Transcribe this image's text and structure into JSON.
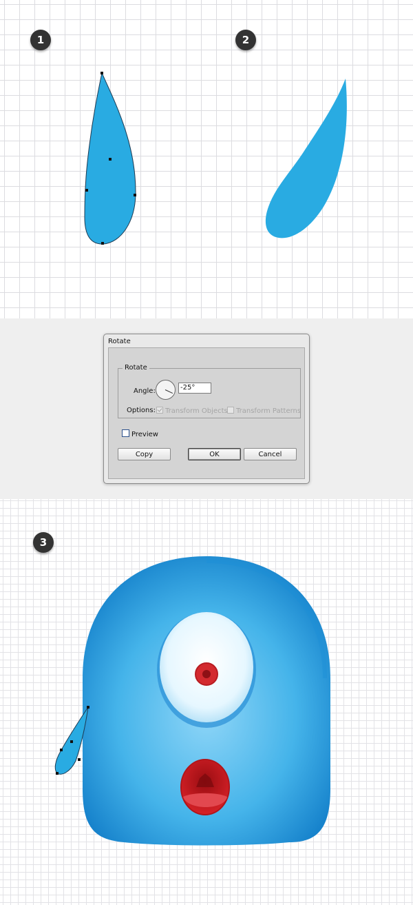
{
  "steps": {
    "one": "1",
    "two": "2",
    "three": "3"
  },
  "dialog": {
    "title": "Rotate",
    "group_title": "Rotate",
    "angle_label": "Angle:",
    "angle_value": "-25°",
    "options_label": "Options:",
    "transform_objects": {
      "label": "Transform Objects",
      "checked": true,
      "enabled": false
    },
    "transform_patterns": {
      "label": "Transform Patterns",
      "checked": false,
      "enabled": false
    },
    "preview": {
      "label": "Preview",
      "checked": false
    },
    "buttons": {
      "copy": "Copy",
      "ok": "OK",
      "cancel": "Cancel"
    }
  },
  "colors": {
    "shape_blue": "#29abe2",
    "monster_body": "#2aa0e0",
    "eye_white": "#e8f8ff",
    "pupil_red": "#d32a2f",
    "mouth_red": "#c4161c",
    "grid_line": "#dcdce0",
    "badge": "#333333"
  },
  "icons": [
    "dial-icon",
    "checkbox-icon"
  ]
}
